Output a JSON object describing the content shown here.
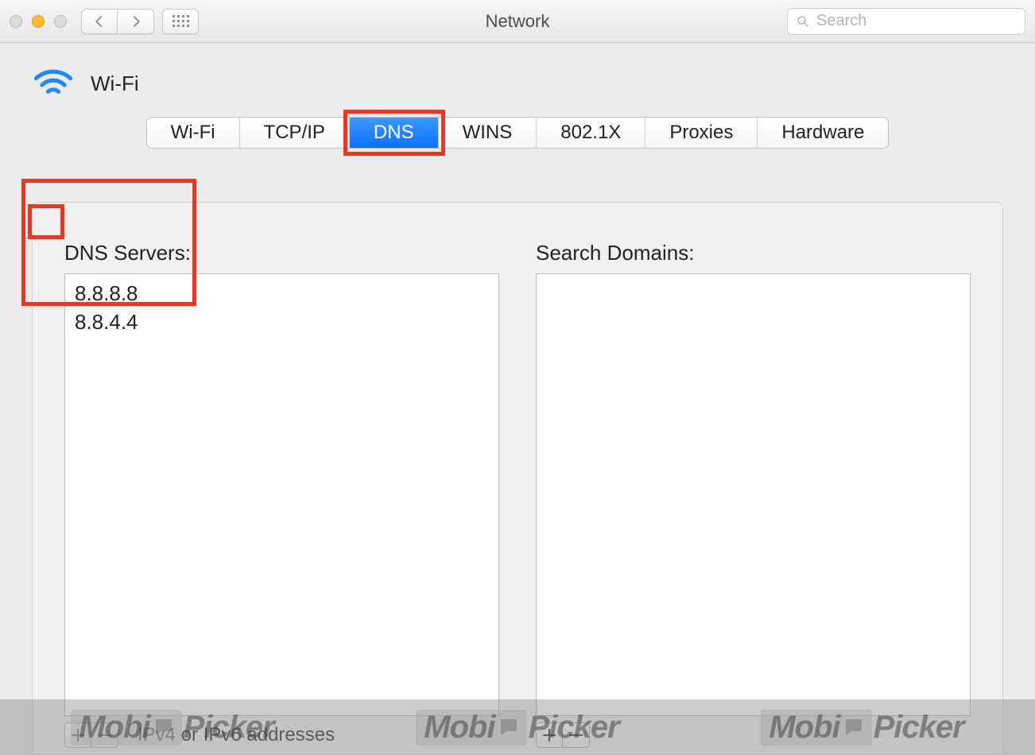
{
  "window": {
    "title": "Network"
  },
  "search": {
    "placeholder": "Search"
  },
  "connection": {
    "name": "Wi-Fi"
  },
  "tabs": [
    {
      "id": "wifi",
      "label": "Wi-Fi",
      "active": false
    },
    {
      "id": "tcpip",
      "label": "TCP/IP",
      "active": false
    },
    {
      "id": "dns",
      "label": "DNS",
      "active": true
    },
    {
      "id": "wins",
      "label": "WINS",
      "active": false
    },
    {
      "id": "8021x",
      "label": "802.1X",
      "active": false
    },
    {
      "id": "proxies",
      "label": "Proxies",
      "active": false
    },
    {
      "id": "hardware",
      "label": "Hardware",
      "active": false
    }
  ],
  "dns": {
    "servers_label": "DNS Servers:",
    "servers": [
      "8.8.8.8",
      "8.8.4.4"
    ],
    "search_domains_label": "Search Domains:",
    "search_domains": [],
    "hint": "IPv4 or IPv6 addresses"
  },
  "watermark": {
    "brand_left": "Mobi",
    "brand_right": "Picker"
  },
  "colors": {
    "accent": "#0a72ff",
    "highlight": "#ee3524"
  }
}
